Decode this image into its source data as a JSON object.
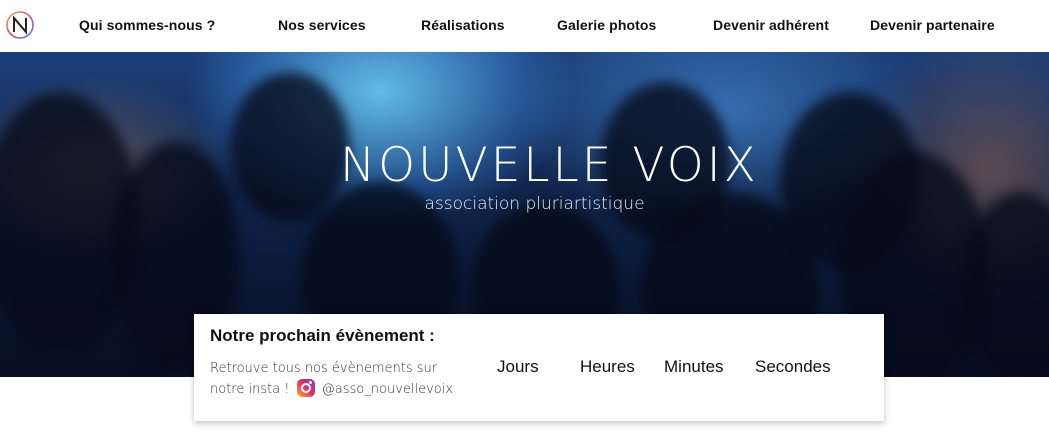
{
  "nav": {
    "logo_icon": "nouvelle-voix-logo-icon",
    "items": [
      {
        "label": "Qui sommes-nous ?"
      },
      {
        "label": "Nos services"
      },
      {
        "label": "Réalisations"
      },
      {
        "label": "Galerie photos"
      },
      {
        "label": "Devenir adhérent"
      },
      {
        "label": "Devenir partenaire"
      }
    ]
  },
  "hero": {
    "title": "NOUVELLE VOIX",
    "subtitle": "association pluriartistique"
  },
  "event": {
    "title": "Notre prochain évènement :",
    "text_line1": "Retrouve tous nos évènements sur",
    "text_line2_prefix": "notre insta !",
    "instagram_icon": "instagram-icon",
    "handle": "@asso_nouvellevoix",
    "countdown": {
      "days": "Jours",
      "hours": "Heures",
      "minutes": "Minutes",
      "seconds": "Secondes"
    }
  },
  "colors": {
    "nav_bg": "#ffffff",
    "hero_bg": "#10244a",
    "card_bg": "#ffffff",
    "text": "#111111"
  }
}
